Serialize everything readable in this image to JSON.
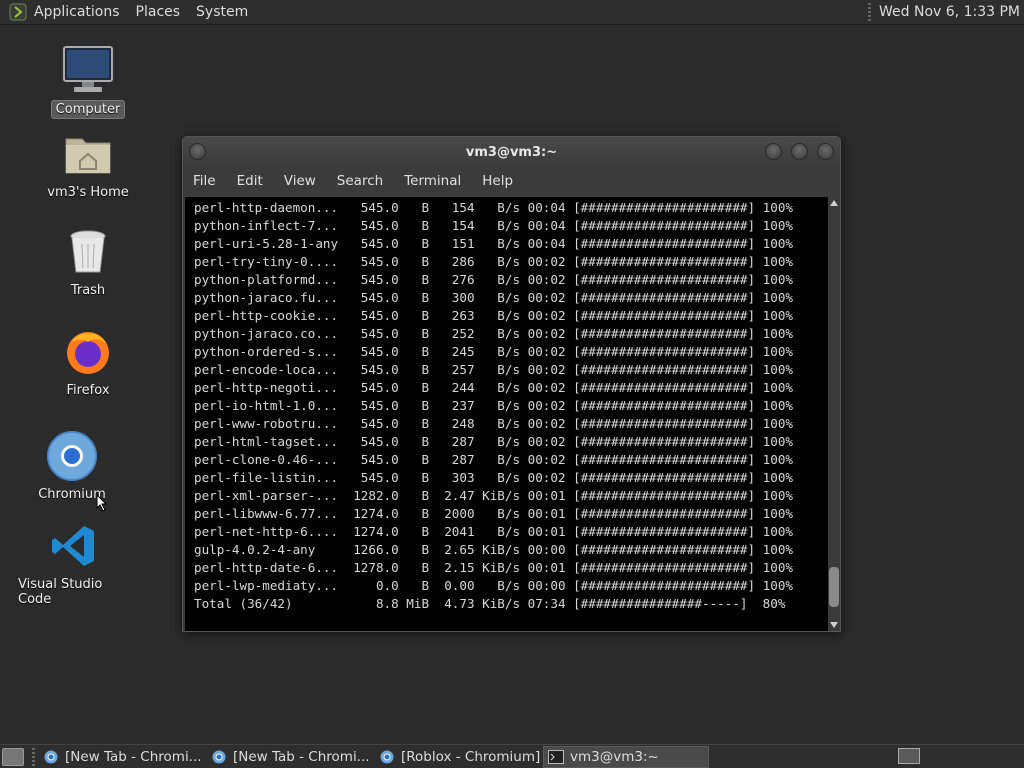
{
  "top_panel": {
    "menus": [
      "Applications",
      "Places",
      "System"
    ],
    "clock": "Wed Nov  6,  1:33 PM"
  },
  "desktop": {
    "icons": [
      {
        "label": "Computer",
        "icon": "computer-icon",
        "selected": true
      },
      {
        "label": "vm3's Home",
        "icon": "home-folder-icon"
      },
      {
        "label": "Trash",
        "icon": "trash-icon"
      },
      {
        "label": "Firefox",
        "icon": "firefox-icon"
      },
      {
        "label": "Chromium",
        "icon": "chromium-icon"
      },
      {
        "label": "Visual Studio Code",
        "icon": "vscode-icon"
      }
    ]
  },
  "terminal": {
    "title": "vm3@vm3:~",
    "menus": [
      "File",
      "Edit",
      "View",
      "Search",
      "Terminal",
      "Help"
    ],
    "lines": [
      "perl-http-daemon...   545.0   B   154   B/s 00:04 [######################] 100%",
      "python-inflect-7...   545.0   B   154   B/s 00:04 [######################] 100%",
      "perl-uri-5.28-1-any   545.0   B   151   B/s 00:04 [######################] 100%",
      "perl-try-tiny-0....   545.0   B   286   B/s 00:02 [######################] 100%",
      "python-platformd...   545.0   B   276   B/s 00:02 [######################] 100%",
      "python-jaraco.fu...   545.0   B   300   B/s 00:02 [######################] 100%",
      "perl-http-cookie...   545.0   B   263   B/s 00:02 [######################] 100%",
      "python-jaraco.co...   545.0   B   252   B/s 00:02 [######################] 100%",
      "python-ordered-s...   545.0   B   245   B/s 00:02 [######################] 100%",
      "perl-encode-loca...   545.0   B   257   B/s 00:02 [######################] 100%",
      "perl-http-negoti...   545.0   B   244   B/s 00:02 [######################] 100%",
      "perl-io-html-1.0...   545.0   B   237   B/s 00:02 [######################] 100%",
      "perl-www-robotru...   545.0   B   248   B/s 00:02 [######################] 100%",
      "perl-html-tagset...   545.0   B   287   B/s 00:02 [######################] 100%",
      "perl-clone-0.46-...   545.0   B   287   B/s 00:02 [######################] 100%",
      "perl-file-listin...   545.0   B   303   B/s 00:02 [######################] 100%",
      "perl-xml-parser-...  1282.0   B  2.47 KiB/s 00:01 [######################] 100%",
      "perl-libwww-6.77...  1274.0   B  2000   B/s 00:01 [######################] 100%",
      "perl-net-http-6....  1274.0   B  2041   B/s 00:01 [######################] 100%",
      "gulp-4.0.2-4-any     1266.0   B  2.65 KiB/s 00:00 [######################] 100%",
      "perl-http-date-6...  1278.0   B  2.15 KiB/s 00:01 [######################] 100%",
      "perl-lwp-mediaty...     0.0   B  0.00   B/s 00:00 [######################] 100%",
      "Total (36/42)           8.8 MiB  4.73 KiB/s 07:34 [################-----]  80%"
    ]
  },
  "taskbar": {
    "tasks": [
      {
        "label": "[New Tab - Chromi...",
        "icon": "chromium-icon",
        "active": false
      },
      {
        "label": "[New Tab - Chromi...",
        "icon": "chromium-icon",
        "active": false
      },
      {
        "label": "[Roblox - Chromium]",
        "icon": "chromium-icon",
        "active": false
      },
      {
        "label": "vm3@vm3:~",
        "icon": "terminal-icon",
        "active": true
      }
    ]
  }
}
